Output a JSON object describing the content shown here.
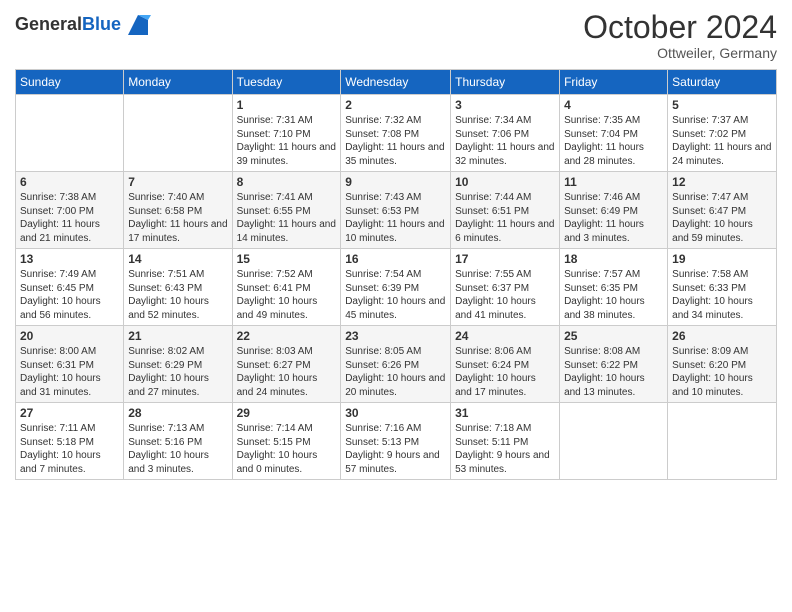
{
  "logo": {
    "general": "General",
    "blue": "Blue"
  },
  "header": {
    "title": "October 2024",
    "location": "Ottweiler, Germany"
  },
  "calendar": {
    "headers": [
      "Sunday",
      "Monday",
      "Tuesday",
      "Wednesday",
      "Thursday",
      "Friday",
      "Saturday"
    ],
    "weeks": [
      [
        {
          "day": "",
          "sunrise": "",
          "sunset": "",
          "daylight": ""
        },
        {
          "day": "",
          "sunrise": "",
          "sunset": "",
          "daylight": ""
        },
        {
          "day": "1",
          "sunrise": "Sunrise: 7:31 AM",
          "sunset": "Sunset: 7:10 PM",
          "daylight": "Daylight: 11 hours and 39 minutes."
        },
        {
          "day": "2",
          "sunrise": "Sunrise: 7:32 AM",
          "sunset": "Sunset: 7:08 PM",
          "daylight": "Daylight: 11 hours and 35 minutes."
        },
        {
          "day": "3",
          "sunrise": "Sunrise: 7:34 AM",
          "sunset": "Sunset: 7:06 PM",
          "daylight": "Daylight: 11 hours and 32 minutes."
        },
        {
          "day": "4",
          "sunrise": "Sunrise: 7:35 AM",
          "sunset": "Sunset: 7:04 PM",
          "daylight": "Daylight: 11 hours and 28 minutes."
        },
        {
          "day": "5",
          "sunrise": "Sunrise: 7:37 AM",
          "sunset": "Sunset: 7:02 PM",
          "daylight": "Daylight: 11 hours and 24 minutes."
        }
      ],
      [
        {
          "day": "6",
          "sunrise": "Sunrise: 7:38 AM",
          "sunset": "Sunset: 7:00 PM",
          "daylight": "Daylight: 11 hours and 21 minutes."
        },
        {
          "day": "7",
          "sunrise": "Sunrise: 7:40 AM",
          "sunset": "Sunset: 6:58 PM",
          "daylight": "Daylight: 11 hours and 17 minutes."
        },
        {
          "day": "8",
          "sunrise": "Sunrise: 7:41 AM",
          "sunset": "Sunset: 6:55 PM",
          "daylight": "Daylight: 11 hours and 14 minutes."
        },
        {
          "day": "9",
          "sunrise": "Sunrise: 7:43 AM",
          "sunset": "Sunset: 6:53 PM",
          "daylight": "Daylight: 11 hours and 10 minutes."
        },
        {
          "day": "10",
          "sunrise": "Sunrise: 7:44 AM",
          "sunset": "Sunset: 6:51 PM",
          "daylight": "Daylight: 11 hours and 6 minutes."
        },
        {
          "day": "11",
          "sunrise": "Sunrise: 7:46 AM",
          "sunset": "Sunset: 6:49 PM",
          "daylight": "Daylight: 11 hours and 3 minutes."
        },
        {
          "day": "12",
          "sunrise": "Sunrise: 7:47 AM",
          "sunset": "Sunset: 6:47 PM",
          "daylight": "Daylight: 10 hours and 59 minutes."
        }
      ],
      [
        {
          "day": "13",
          "sunrise": "Sunrise: 7:49 AM",
          "sunset": "Sunset: 6:45 PM",
          "daylight": "Daylight: 10 hours and 56 minutes."
        },
        {
          "day": "14",
          "sunrise": "Sunrise: 7:51 AM",
          "sunset": "Sunset: 6:43 PM",
          "daylight": "Daylight: 10 hours and 52 minutes."
        },
        {
          "day": "15",
          "sunrise": "Sunrise: 7:52 AM",
          "sunset": "Sunset: 6:41 PM",
          "daylight": "Daylight: 10 hours and 49 minutes."
        },
        {
          "day": "16",
          "sunrise": "Sunrise: 7:54 AM",
          "sunset": "Sunset: 6:39 PM",
          "daylight": "Daylight: 10 hours and 45 minutes."
        },
        {
          "day": "17",
          "sunrise": "Sunrise: 7:55 AM",
          "sunset": "Sunset: 6:37 PM",
          "daylight": "Daylight: 10 hours and 41 minutes."
        },
        {
          "day": "18",
          "sunrise": "Sunrise: 7:57 AM",
          "sunset": "Sunset: 6:35 PM",
          "daylight": "Daylight: 10 hours and 38 minutes."
        },
        {
          "day": "19",
          "sunrise": "Sunrise: 7:58 AM",
          "sunset": "Sunset: 6:33 PM",
          "daylight": "Daylight: 10 hours and 34 minutes."
        }
      ],
      [
        {
          "day": "20",
          "sunrise": "Sunrise: 8:00 AM",
          "sunset": "Sunset: 6:31 PM",
          "daylight": "Daylight: 10 hours and 31 minutes."
        },
        {
          "day": "21",
          "sunrise": "Sunrise: 8:02 AM",
          "sunset": "Sunset: 6:29 PM",
          "daylight": "Daylight: 10 hours and 27 minutes."
        },
        {
          "day": "22",
          "sunrise": "Sunrise: 8:03 AM",
          "sunset": "Sunset: 6:27 PM",
          "daylight": "Daylight: 10 hours and 24 minutes."
        },
        {
          "day": "23",
          "sunrise": "Sunrise: 8:05 AM",
          "sunset": "Sunset: 6:26 PM",
          "daylight": "Daylight: 10 hours and 20 minutes."
        },
        {
          "day": "24",
          "sunrise": "Sunrise: 8:06 AM",
          "sunset": "Sunset: 6:24 PM",
          "daylight": "Daylight: 10 hours and 17 minutes."
        },
        {
          "day": "25",
          "sunrise": "Sunrise: 8:08 AM",
          "sunset": "Sunset: 6:22 PM",
          "daylight": "Daylight: 10 hours and 13 minutes."
        },
        {
          "day": "26",
          "sunrise": "Sunrise: 8:09 AM",
          "sunset": "Sunset: 6:20 PM",
          "daylight": "Daylight: 10 hours and 10 minutes."
        }
      ],
      [
        {
          "day": "27",
          "sunrise": "Sunrise: 7:11 AM",
          "sunset": "Sunset: 5:18 PM",
          "daylight": "Daylight: 10 hours and 7 minutes."
        },
        {
          "day": "28",
          "sunrise": "Sunrise: 7:13 AM",
          "sunset": "Sunset: 5:16 PM",
          "daylight": "Daylight: 10 hours and 3 minutes."
        },
        {
          "day": "29",
          "sunrise": "Sunrise: 7:14 AM",
          "sunset": "Sunset: 5:15 PM",
          "daylight": "Daylight: 10 hours and 0 minutes."
        },
        {
          "day": "30",
          "sunrise": "Sunrise: 7:16 AM",
          "sunset": "Sunset: 5:13 PM",
          "daylight": "Daylight: 9 hours and 57 minutes."
        },
        {
          "day": "31",
          "sunrise": "Sunrise: 7:18 AM",
          "sunset": "Sunset: 5:11 PM",
          "daylight": "Daylight: 9 hours and 53 minutes."
        },
        {
          "day": "",
          "sunrise": "",
          "sunset": "",
          "daylight": ""
        },
        {
          "day": "",
          "sunrise": "",
          "sunset": "",
          "daylight": ""
        }
      ]
    ]
  }
}
